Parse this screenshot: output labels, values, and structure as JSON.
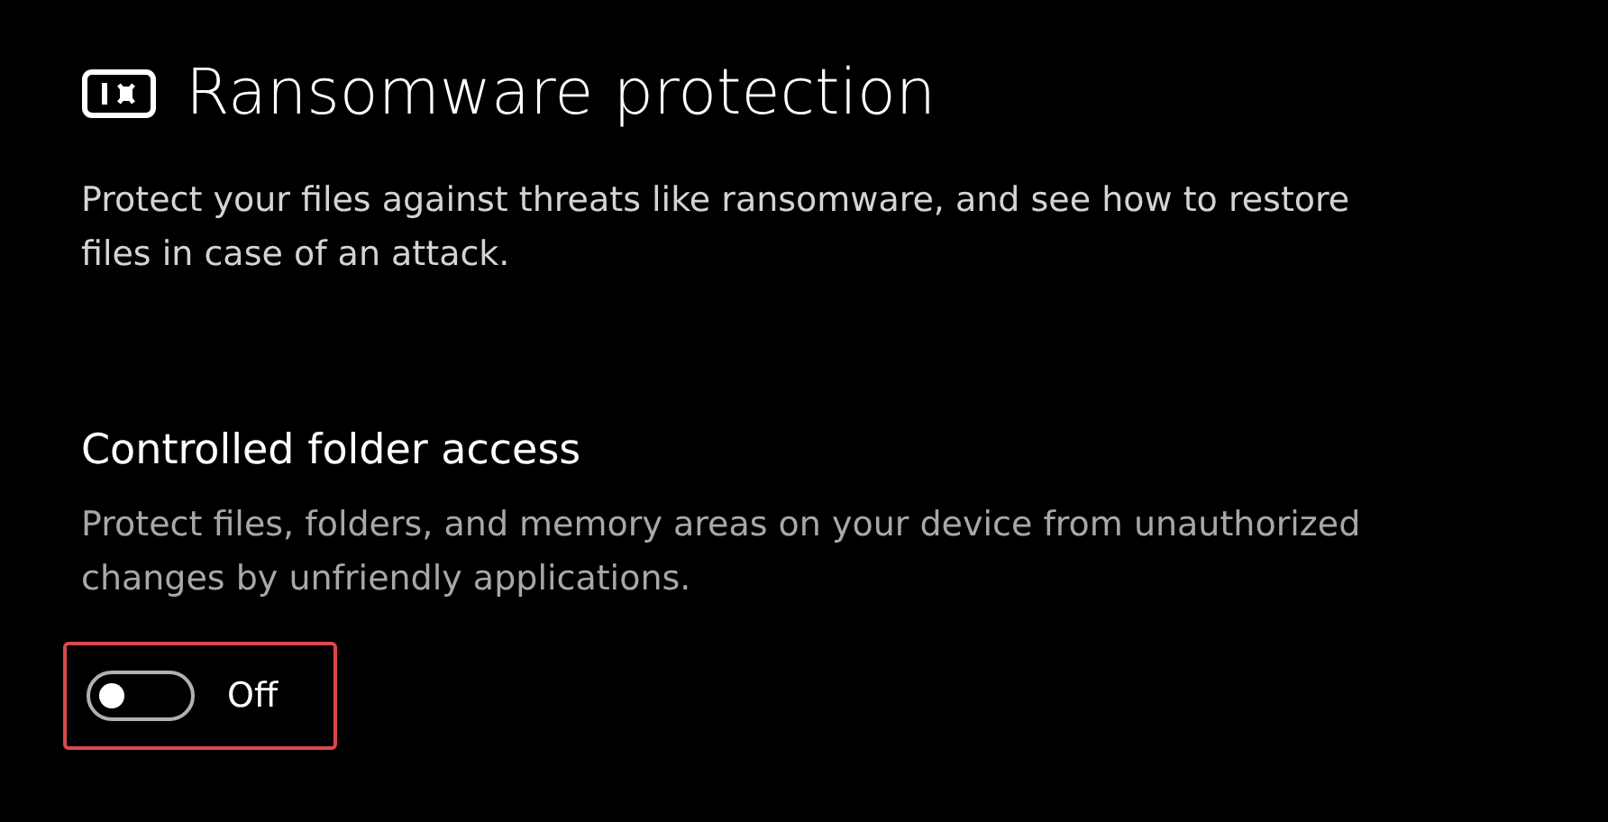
{
  "header": {
    "title": "Ransomware protection",
    "description": "Protect your files against threats like ransomware, and see how to restore files in case of an attack."
  },
  "section": {
    "title": "Controlled folder access",
    "description": "Protect files, folders, and memory areas on your device from unauthorized changes by unfriendly applications.",
    "toggle": {
      "on": false,
      "label": "Off",
      "highlighted": true
    }
  }
}
